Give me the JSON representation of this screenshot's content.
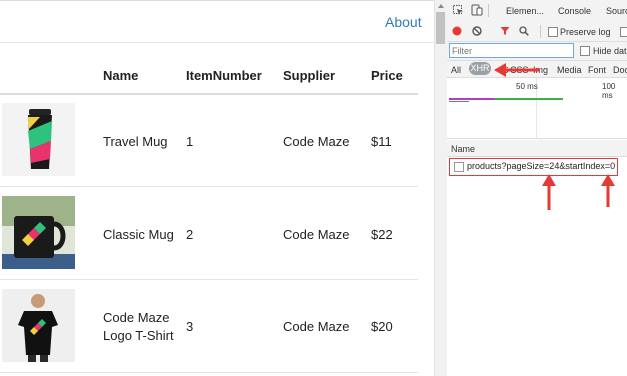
{
  "navbar": {
    "about_label": "About"
  },
  "table": {
    "headers": {
      "name": "Name",
      "item_number": "ItemNumber",
      "supplier": "Supplier",
      "price": "Price"
    },
    "rows": [
      {
        "name": "Travel Mug",
        "name_line2": "",
        "item_number": "1",
        "supplier": "Code Maze",
        "price": "$11",
        "image": "travel-mug-image"
      },
      {
        "name": "Classic Mug",
        "name_line2": "",
        "item_number": "2",
        "supplier": "Code Maze",
        "price": "$22",
        "image": "classic-mug-image"
      },
      {
        "name": "Code Maze",
        "name_line2": "Logo T-Shirt",
        "item_number": "3",
        "supplier": "Code Maze",
        "price": "$20",
        "image": "tshirt-image"
      }
    ]
  },
  "devtools": {
    "tabs": {
      "elements": "Elemen...",
      "console": "Console",
      "sources": "Sourc"
    },
    "toolbar": {
      "preserve_log": "Preserve log"
    },
    "filter": {
      "placeholder": "Filter",
      "hide_data_urls": "Hide dat"
    },
    "types": {
      "all": "All",
      "xhr": "XHR",
      "js": "JS",
      "css": "CSS",
      "img": "Img",
      "media": "Media",
      "font": "Font",
      "doc": "Doc"
    },
    "timeline": {
      "tick1": "50 ms",
      "tick2": "100 ms"
    },
    "requests_header": {
      "name": "Name"
    },
    "requests": [
      {
        "name": "products?pageSize=24&startIndex=0"
      }
    ]
  },
  "colors": {
    "link": "#337ab7",
    "record": "#e53935",
    "annotation": "#e53935",
    "highlight_border": "#e53935"
  }
}
